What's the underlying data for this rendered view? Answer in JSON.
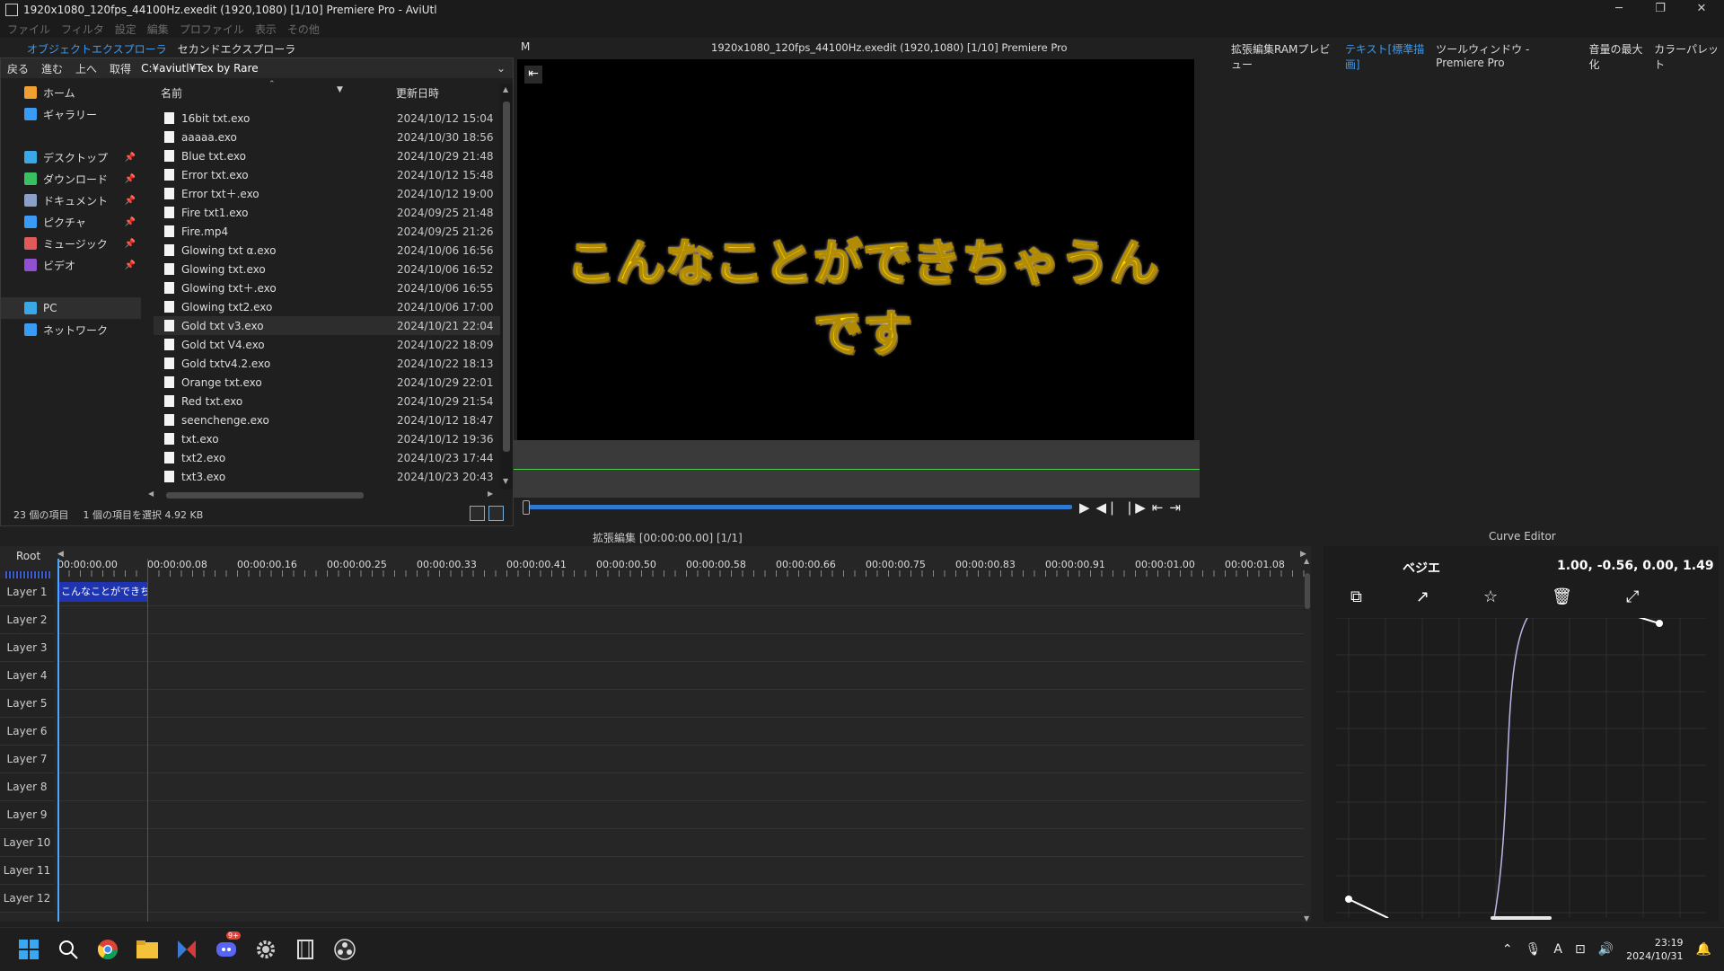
{
  "window": {
    "title": "1920x1080_120fps_44100Hz.exedit (1920,1080)  [1/10]  Premiere Pro - AviUtl"
  },
  "menu": [
    "ファイル",
    "フィルタ",
    "設定",
    "編集",
    "プロファイル",
    "表示",
    "その他"
  ],
  "left_tabs": [
    "オブジェクトエクスプローラ",
    "セカンドエクスプローラ"
  ],
  "explorer": {
    "nav": [
      "戻る",
      "進む",
      "上へ",
      "取得"
    ],
    "path": "C:¥aviutl¥Tex by Rare",
    "tree": [
      {
        "label": "ホーム",
        "color": "#f0a030"
      },
      {
        "label": "ギャラリー",
        "color": "#3a9bf5"
      },
      {
        "label": "デスクトップ",
        "color": "#3aa7e8",
        "pin": true
      },
      {
        "label": "ダウンロード",
        "color": "#3ac060",
        "pin": true
      },
      {
        "label": "ドキュメント",
        "color": "#8aa0c8",
        "pin": true
      },
      {
        "label": "ピクチャ",
        "color": "#3a9bf5",
        "pin": true
      },
      {
        "label": "ミュージック",
        "color": "#e05a5a",
        "pin": true
      },
      {
        "label": "ビデオ",
        "color": "#9050d0",
        "pin": true
      },
      {
        "label": "PC",
        "color": "#3aa7e8"
      },
      {
        "label": "ネットワーク",
        "color": "#3a9bf5"
      }
    ],
    "col_name": "名前",
    "col_date": "更新日時",
    "files": [
      {
        "name": "16bit txt.exo",
        "date": "2024/10/12 15:04"
      },
      {
        "name": "aaaaa.exo",
        "date": "2024/10/30 18:56"
      },
      {
        "name": "Blue txt.exo",
        "date": "2024/10/29 21:48"
      },
      {
        "name": "Error txt.exo",
        "date": "2024/10/12 15:48"
      },
      {
        "name": "Error txt＋.exo",
        "date": "2024/10/12 19:00"
      },
      {
        "name": "Fire txt1.exo",
        "date": "2024/09/25 21:48"
      },
      {
        "name": "Fire.mp4",
        "date": "2024/09/25 21:26"
      },
      {
        "name": "Glowing txt α.exo",
        "date": "2024/10/06 16:56"
      },
      {
        "name": "Glowing txt.exo",
        "date": "2024/10/06 16:52"
      },
      {
        "name": "Glowing txt＋.exo",
        "date": "2024/10/06 16:55"
      },
      {
        "name": "Glowing txt2.exo",
        "date": "2024/10/06 17:00"
      },
      {
        "name": "Gold txt v3.exo",
        "date": "2024/10/21 22:04"
      },
      {
        "name": "Gold txt V4.exo",
        "date": "2024/10/22 18:09"
      },
      {
        "name": "Gold txtv4.2.exo",
        "date": "2024/10/22 18:13"
      },
      {
        "name": "Orange txt.exo",
        "date": "2024/10/29 22:01"
      },
      {
        "name": "Red txt.exo",
        "date": "2024/10/29 21:54"
      },
      {
        "name": "seenchenge.exo",
        "date": "2024/10/12 18:47"
      },
      {
        "name": "txt.exo",
        "date": "2024/10/12 19:36"
      },
      {
        "name": "txt2.exo",
        "date": "2024/10/23 17:44"
      },
      {
        "name": "txt3.exo",
        "date": "2024/10/23 20:43"
      }
    ],
    "status_count": "23 個の項目",
    "status_sel": "1 個の項目を選択  4.92 KB"
  },
  "preview": {
    "m": "M",
    "title": "1920x1080_120fps_44100Hz.exedit (1920,1080)  [1/10]  Premiere Pro",
    "caption": "こんなことができちゃうんです"
  },
  "right_tabs": [
    "拡張編集RAMプレビュー",
    "テキスト[標準描画]",
    "ツールウィンドウ - Premiere Pro",
    "音量の最大化",
    "カラーパレット"
  ],
  "timeline": {
    "title": "拡張編集 [00:00:00.00] [1/1]",
    "root": "Root",
    "ticks": [
      "00:00:00.00",
      "00:00:00.08",
      "00:00:00.16",
      "00:00:00.25",
      "00:00:00.33",
      "00:00:00.41",
      "00:00:00.50",
      "00:00:00.58",
      "00:00:00.66",
      "00:00:00.75",
      "00:00:00.83",
      "00:00:00.91",
      "00:00:01.00",
      "00:00:01.08"
    ],
    "layers": [
      "Layer 1",
      "Layer 2",
      "Layer 3",
      "Layer 4",
      "Layer 5",
      "Layer 6",
      "Layer 7",
      "Layer 8",
      "Layer 9",
      "Layer 10",
      "Layer 11",
      "Layer 12"
    ],
    "clip": "こんなことができちゃう"
  },
  "curve": {
    "title": "Curve Editor",
    "name": "ベジエ",
    "values": "1.00, -0.56, 0.00, 1.49"
  },
  "taskbar": {
    "time": "23:19",
    "date": "2024/10/31",
    "badge": "9+"
  }
}
